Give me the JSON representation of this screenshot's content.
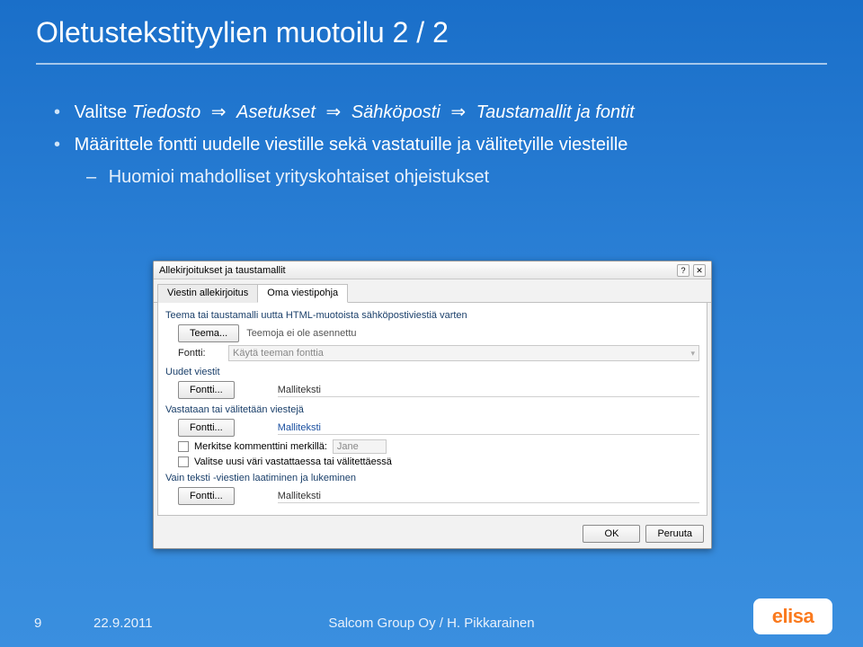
{
  "slide": {
    "title": "Oletustekstityylien muotoilu 2 / 2"
  },
  "bullets": {
    "b1_prefix": "Valitse ",
    "b1_path": [
      "Tiedosto",
      "Asetukset",
      "Sähköposti",
      "Taustamallit ja fontit"
    ],
    "b2": "Määrittele fontti uudelle viestille sekä vastatuille ja välitetyille viesteille",
    "b3": "Huomioi mahdolliset yrityskohtaiset ohjeistukset"
  },
  "dialog": {
    "title": "Allekirjoitukset ja taustamallit",
    "tabs": {
      "t1": "Viestin allekirjoitus",
      "t2": "Oma viestipohja"
    },
    "sec_theme": {
      "heading": "Teema tai taustamalli uutta HTML-muotoista sähköpostiviestiä varten",
      "theme_btn": "Teema...",
      "theme_info": "Teemoja ei ole asennettu",
      "font_lbl": "Fontti:",
      "font_sel": "Käytä teeman fonttia"
    },
    "sec_new": {
      "heading": "Uudet viestit",
      "font_btn": "Fontti...",
      "sample": "Malliteksti"
    },
    "sec_reply": {
      "heading": "Vastataan tai välitetään viestejä",
      "font_btn": "Fontti...",
      "sample": "Malliteksti",
      "chk1": "Merkitse kommenttini merkillä:",
      "chk1_val": "Jane",
      "chk2": "Valitse uusi väri vastattaessa tai välitettäessä"
    },
    "sec_plain": {
      "heading": "Vain teksti -viestien laatiminen ja lukeminen",
      "font_btn": "Fontti...",
      "sample": "Malliteksti"
    },
    "ok": "OK",
    "cancel": "Peruuta"
  },
  "footer": {
    "page": "9",
    "date": "22.9.2011",
    "mid": "Salcom Group Oy / H. Pikkarainen",
    "logo": "elisa"
  }
}
